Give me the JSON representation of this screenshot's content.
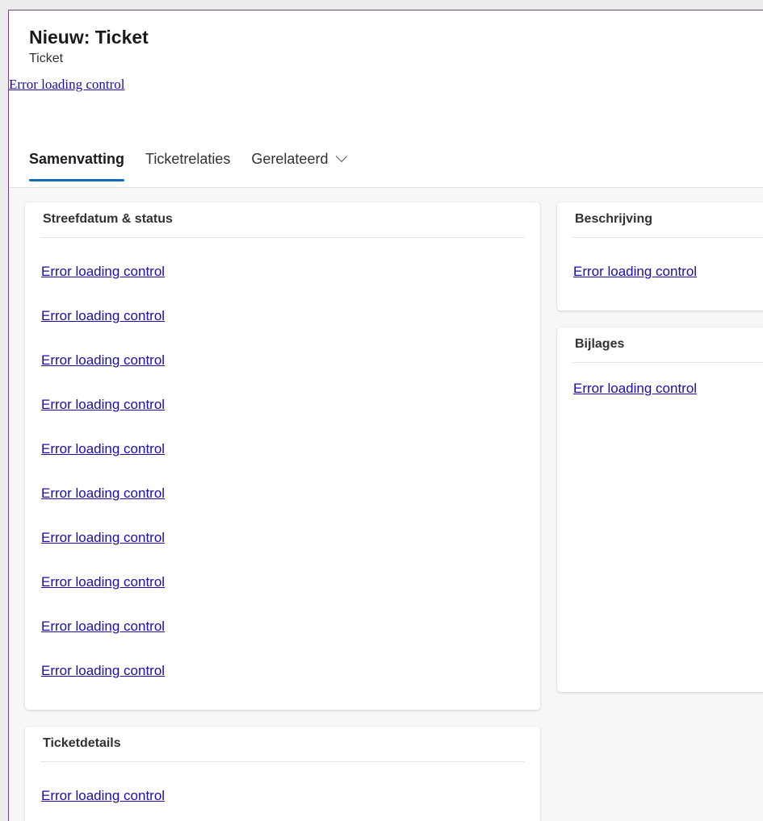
{
  "header": {
    "title": "Nieuw: Ticket",
    "subtitle": "Ticket",
    "error_link": "Error loading control"
  },
  "tabs": [
    {
      "label": "Samenvatting",
      "active": true
    },
    {
      "label": "Ticketrelaties",
      "active": false
    },
    {
      "label": "Gerelateerd",
      "active": false,
      "has_dropdown": true
    }
  ],
  "sections": {
    "target_status": {
      "title": "Streefdatum & status",
      "controls": [
        "Error loading control",
        "Error loading control",
        "Error loading control",
        "Error loading control",
        "Error loading control",
        "Error loading control",
        "Error loading control",
        "Error loading control",
        "Error loading control",
        "Error loading control"
      ]
    },
    "ticket_details": {
      "title": "Ticketdetails",
      "controls": [
        "Error loading control"
      ]
    },
    "description": {
      "title": "Beschrijving",
      "controls": [
        "Error loading control"
      ]
    },
    "attachments": {
      "title": "Bijlages",
      "controls": [
        "Error loading control"
      ]
    }
  },
  "colors": {
    "link": "#1a0dab",
    "tab_underline": "#0f6cbd",
    "window_border": "#7a3f86"
  },
  "icons": {
    "gerelateerd_dropdown": "chevron-down-icon"
  }
}
